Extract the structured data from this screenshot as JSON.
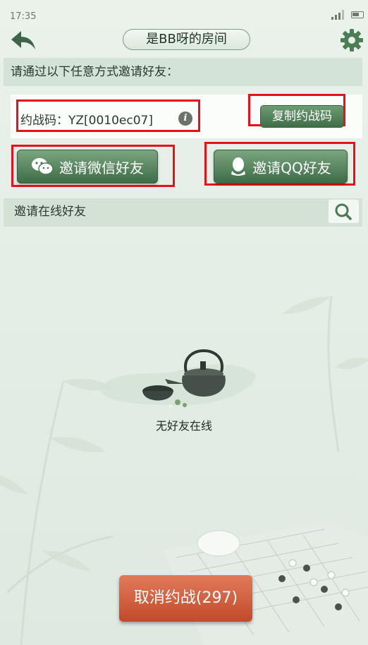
{
  "status_bar": {
    "time": "17:35"
  },
  "header": {
    "room_title": "是BB呀的房间"
  },
  "invite": {
    "prompt": "请通过以下任意方式邀请好友：",
    "battle_code_text": "约战码：YZ[0010ec07]",
    "copy_button": "复制约战码",
    "wechat_button": "邀请微信好友",
    "qq_button": "邀请QQ好友"
  },
  "online": {
    "title": "邀请在线好友",
    "empty_text": "无好友在线"
  },
  "footer": {
    "cancel_button": "取消约战(297)"
  },
  "colors": {
    "accent_green": "#4a7a52",
    "cancel_orange": "#d4603f",
    "highlight_red": "#e8111b"
  },
  "icons": [
    "back-arrow-icon",
    "gear-icon",
    "info-icon",
    "wechat-icon",
    "qq-icon",
    "search-icon",
    "signal-icon",
    "battery-icon"
  ]
}
